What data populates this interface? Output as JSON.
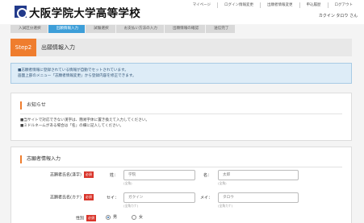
{
  "header": {
    "school_name": "大阪学院大学高等学校",
    "nav": [
      "マイページ",
      "ログイン情報変更",
      "出願者情報変更",
      "申込履歴",
      "ログアウト"
    ],
    "user_name": "カクイン タロウ さん"
  },
  "steps": [
    "入試区分選択",
    "出願情報入力",
    "試験選択",
    "お支払い方法の入力",
    "出願情報の確認",
    "送信完了"
  ],
  "active_step_index": 1,
  "page_header": {
    "badge": "Step2",
    "title": "出願情報入力"
  },
  "info": {
    "lines": [
      "■志願者情報に登録されている情報が自動でセットされています。",
      "画面上部のメニュー「志願者情報変更」から登録内容を修正できます。"
    ]
  },
  "notice": {
    "title": "お知らせ",
    "lines": [
      "■当サイトで対応できない漢字は、簡易字体に置き換えて入力してください。",
      "■ミドルネームがある場合は「名」の欄に記入してください。"
    ]
  },
  "applicant": {
    "title": "志願者情報入力",
    "required_badge": "必須",
    "name_kanji": {
      "label": "志願者氏名(漢字)",
      "sei_label": "姓：",
      "mei_label": "名：",
      "sei_value": "学院",
      "mei_value": "太郎",
      "sei_hint": "(全角)",
      "mei_hint": "(全角)"
    },
    "name_kana": {
      "label": "志願者氏名(カナ)",
      "sei_label": "セイ：",
      "mei_label": "メイ：",
      "sei_value": "ガクイン",
      "mei_value": "タロウ",
      "sei_hint": "(全角カナ)",
      "mei_hint": "(全角カナ)"
    },
    "gender": {
      "label": "性別",
      "options": [
        "男",
        "女"
      ],
      "selected": "男"
    }
  }
}
